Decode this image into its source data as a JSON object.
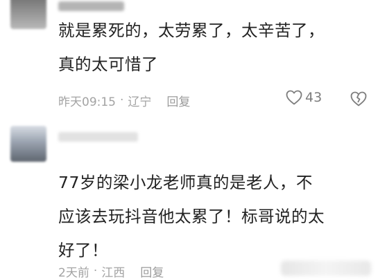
{
  "comments": [
    {
      "text": "就是累死的，太劳累了，太辛苦了，\n真的太可惜了",
      "time": "昨天09:15",
      "location": "辽宁",
      "reply_label": "回复",
      "likes": "43",
      "like_icon": "heart-outline-icon",
      "dislike_icon": "broken-heart-icon"
    },
    {
      "text": "77岁的梁小龙老师真的是老人，不\n应该去玩抖音他太累了！标哥说的太\n好了！",
      "time": "2天前",
      "location": "江西",
      "reply_label": "回复"
    }
  ],
  "separator": "·",
  "colors": {
    "text": "#222222",
    "meta": "#a3a3a3",
    "icon": "#7d7d7d"
  }
}
